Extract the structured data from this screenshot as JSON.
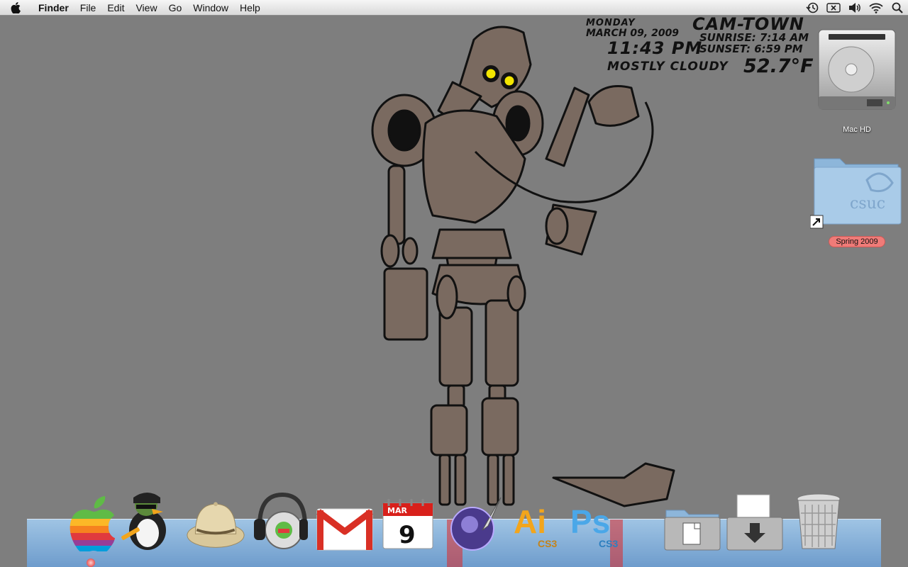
{
  "menubar": {
    "apple_icon": "apple-logo-icon",
    "app_name": "Finder",
    "menus": [
      "File",
      "Edit",
      "View",
      "Go",
      "Window",
      "Help"
    ],
    "status_icons": [
      "time-machine-icon",
      "eject-icon",
      "volume-icon",
      "wifi-icon",
      "spotlight-search-icon"
    ]
  },
  "widget": {
    "day": "MONDAY",
    "date": "MARCH 09, 2009",
    "time": "11:43 PM",
    "condition": "MOSTLY CLOUDY",
    "temperature": "52.7°F",
    "city": "CAM-TOWN",
    "sunrise": "SUNRISE: 7:14 AM",
    "sunset": "SUNSET: 6:59 PM"
  },
  "desktop": {
    "hard_drive_label": "Mac HD",
    "folder_label": "Spring 2009",
    "folder_emblem_text": "csuc",
    "tag_color": "#f07b78"
  },
  "dock": {
    "calendar_month": "MAR",
    "calendar_day": "9",
    "illustrator_label": "Ai",
    "illustrator_version": "CS3",
    "photoshop_label": "Ps",
    "photoshop_version": "CS3",
    "items": [
      "rainbow-apple-icon",
      "penguin-hockey-icon",
      "safari-helmet-icon",
      "itunes-headphones-icon",
      "gmail-icon",
      "ical-icon",
      "app-quill-icon",
      "illustrator-icon",
      "photoshop-icon",
      "documents-stack-icon",
      "downloads-stack-icon",
      "trash-icon"
    ]
  },
  "colors": {
    "desktop_background": "#7e7e7e",
    "robot_body": "#7a6a60",
    "robot_eyes": "#f3e600",
    "dock_blue": "#6e9ccc",
    "ps_blue": "#4aa7e8",
    "ai_orange": "#f2a51c"
  }
}
